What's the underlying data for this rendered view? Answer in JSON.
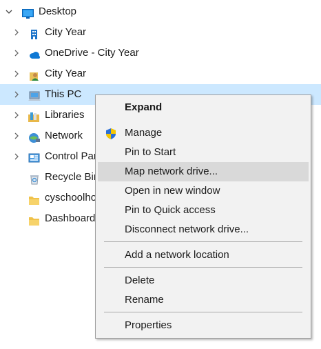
{
  "tree": {
    "items": [
      {
        "label": "Desktop",
        "icon": "desktop-icon",
        "expanded": true
      },
      {
        "label": "City Year",
        "icon": "building-icon"
      },
      {
        "label": "OneDrive - City Year",
        "icon": "onedrive-cloud-icon"
      },
      {
        "label": "City Year",
        "icon": "user-folder-icon"
      },
      {
        "label": "This PC",
        "icon": "computer-icon",
        "selected": true
      },
      {
        "label": "Libraries",
        "icon": "libraries-icon"
      },
      {
        "label": "Network",
        "icon": "network-icon"
      },
      {
        "label": "Control Panel",
        "icon": "control-panel-icon"
      },
      {
        "label": "Recycle Bin",
        "icon": "recycle-bin-icon"
      },
      {
        "label": "cyschoolhouse",
        "icon": "folder-icon"
      },
      {
        "label": "Dashboards",
        "icon": "folder-icon"
      }
    ]
  },
  "context_menu": {
    "items": {
      "expand": "Expand",
      "manage": "Manage",
      "pin_start": "Pin to Start",
      "map_drive": "Map network drive...",
      "open_new_window": "Open in new window",
      "pin_quick": "Pin to Quick access",
      "disconnect": "Disconnect network drive...",
      "add_location": "Add a network location",
      "delete": "Delete",
      "rename": "Rename",
      "properties": "Properties"
    },
    "hovered_item": "Map network drive..."
  },
  "colors": {
    "selection": "#cce8ff",
    "menu_background": "#f2f2f2",
    "menu_hover": "#d9d9d9",
    "shield_blue": "#2b6fd6",
    "shield_yellow": "#f7c700"
  }
}
